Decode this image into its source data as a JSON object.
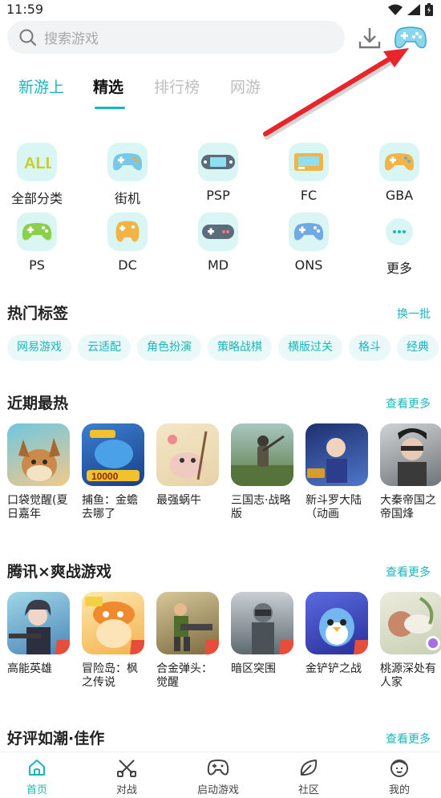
{
  "status_bar": {
    "time": "11:59"
  },
  "search": {
    "placeholder": "搜索游戏"
  },
  "tabs": [
    {
      "label": "新游上"
    },
    {
      "label": "精选"
    },
    {
      "label": "排行榜"
    },
    {
      "label": "网游"
    }
  ],
  "categories": [
    {
      "label": "全部分类",
      "icon": "all-categories-icon"
    },
    {
      "label": "街机",
      "icon": "gamepad-icon"
    },
    {
      "label": "PSP",
      "icon": "handheld-icon"
    },
    {
      "label": "FC",
      "icon": "console-icon"
    },
    {
      "label": "GBA",
      "icon": "gamepad-icon"
    },
    {
      "label": "PS",
      "icon": "gamepad-icon"
    },
    {
      "label": "DC",
      "icon": "gamepad-icon"
    },
    {
      "label": "MD",
      "icon": "gamepad-icon"
    },
    {
      "label": "ONS",
      "icon": "gamepad-icon"
    },
    {
      "label": "更多",
      "icon": "more-icon"
    }
  ],
  "hot_tags": {
    "title": "热门标签",
    "action": "换一批",
    "tags": [
      "网易游戏",
      "云适配",
      "角色扮演",
      "策略战棋",
      "横版过关",
      "格斗",
      "经典"
    ]
  },
  "recent_hot": {
    "title": "近期最热",
    "more": "查看更多",
    "games": [
      {
        "name": "口袋觉醒(夏日嘉年"
      },
      {
        "name": "捕鱼：金蟾去哪了"
      },
      {
        "name": "最强蜗牛"
      },
      {
        "name": "三国志·战略版"
      },
      {
        "name": "新斗罗大陆（动画"
      },
      {
        "name": "大秦帝国之帝国烽"
      }
    ]
  },
  "tencent": {
    "title": "腾讯×爽战游戏",
    "more": "查看更多",
    "games": [
      {
        "name": "高能英雄"
      },
      {
        "name": "冒险岛：枫之传说"
      },
      {
        "name": "合金弹头：觉醒"
      },
      {
        "name": "暗区突围"
      },
      {
        "name": "金铲铲之战"
      },
      {
        "name": "桃源深处有人家"
      }
    ]
  },
  "good_reviews": {
    "title": "好评如潮·佳作",
    "more": "查看更多"
  },
  "bottom_nav": [
    {
      "label": "首页",
      "icon": "home-icon"
    },
    {
      "label": "对战",
      "icon": "versus-icon"
    },
    {
      "label": "启动游戏",
      "icon": "gamepad-icon"
    },
    {
      "label": "社区",
      "icon": "leaf-icon"
    },
    {
      "label": "我的",
      "icon": "profile-face-icon"
    }
  ],
  "colors": {
    "accent": "#19b6bd",
    "icon_bg": "#d9f6f5",
    "arrow": "#e8252a"
  }
}
